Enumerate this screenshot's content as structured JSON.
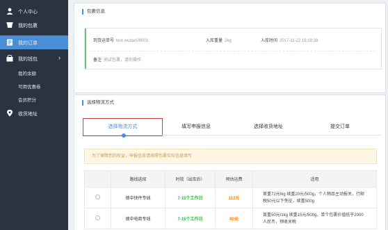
{
  "sidebar": {
    "items": [
      {
        "label": "个人中心",
        "icon": "user-icon"
      },
      {
        "label": "我的包裹",
        "icon": "package-icon"
      },
      {
        "label": "我的订单",
        "icon": "orders-icon"
      },
      {
        "label": "我的钱包",
        "icon": "wallet-icon"
      }
    ],
    "wallet_sub": [
      "我的余额",
      "可用优惠卷",
      "会员积分"
    ],
    "address": {
      "label": "收货地址",
      "icon": "location-icon"
    },
    "active_index": 2
  },
  "package_panel": {
    "title": "包裹信息",
    "tracking_label": "到货运单号",
    "tracking_value": "test-wudan00001",
    "weight_label": "入库重量",
    "weight_value": "2kg",
    "time_label": "入库时间",
    "time_value": "2017-11-22 16:19:38",
    "note_label": "备注",
    "note_value": "测试包裹，请勿操作"
  },
  "logistics_panel": {
    "title": "选择物流方式",
    "tabs": [
      "选择物流方式",
      "填写申报信息",
      "选择收货地址",
      "提交订单"
    ],
    "active_tab": 0,
    "notice": "为了保障您的权益，申报信息请按照包裹实际信息填写"
  },
  "table": {
    "headers": [
      "",
      "路线选择",
      "时效（出库后）",
      "预估运费",
      "适用"
    ],
    "rows": [
      {
        "route": "德中快件专线",
        "time": "7-15个工作日",
        "price": "112元",
        "desc": [
          "首重72元/kg 续重20元/500g，个人物品主动报关，行邮",
          "税50元以下免征，续重500g"
        ]
      },
      {
        "route": "德中电商专线",
        "time": "7-15个工作日",
        "price": "80元",
        "desc": [
          "首重50元/1kg 续重15元/500g，单个包裹价值低于2000",
          "人民币，预收关税"
        ]
      }
    ]
  },
  "colors": {
    "sidebar_bg": "#2b3340",
    "accent": "#4a8fd6",
    "highlight": "#d9383a",
    "green": "#3cb34a",
    "orange": "#ff7a00"
  }
}
